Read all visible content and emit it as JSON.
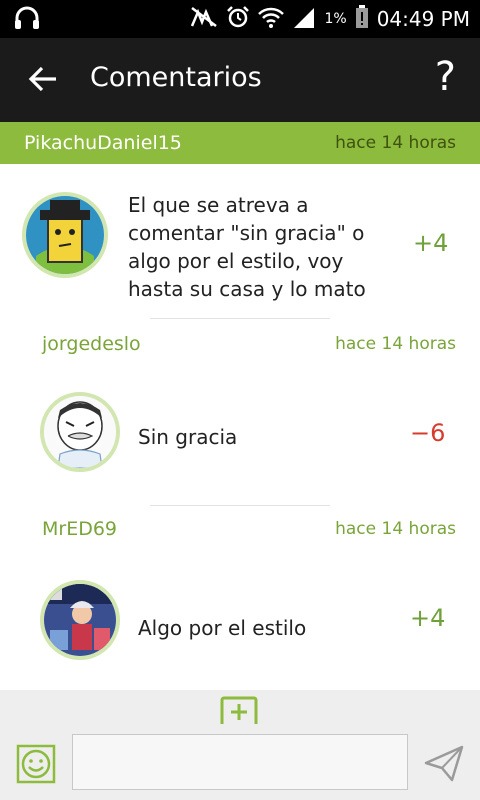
{
  "status_bar": {
    "battery": "1%",
    "time": "04:49 PM"
  },
  "app_bar": {
    "title": "Comentarios",
    "help": "?"
  },
  "comments": [
    {
      "user": "PikachuDaniel15",
      "time": "hace 14 horas",
      "text": "El que se atreva a comentar \"sin gracia\" o algo por el estilo, voy hasta su casa y lo mato",
      "score": "+4"
    },
    {
      "user": "jorgedeslo",
      "time": "hace 14 horas",
      "text": "Sin gracia",
      "score": "−6"
    },
    {
      "user": "MrED69",
      "time": "hace 14 horas",
      "text": "Algo por el estilo",
      "score": "+4"
    }
  ],
  "compose": {
    "input_value": "",
    "placeholder": ""
  },
  "colors": {
    "accent": "#8dbb3d",
    "positive": "#6fa13a",
    "negative": "#d83a2c"
  },
  "icons": [
    "headphones-icon",
    "mute-icon",
    "alarm-icon",
    "wifi-icon",
    "signal-icon",
    "battery-icon",
    "back-arrow-icon",
    "help-icon",
    "add-icon",
    "emoji-icon",
    "send-icon"
  ]
}
